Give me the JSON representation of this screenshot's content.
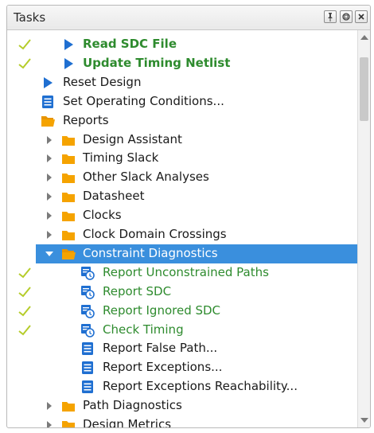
{
  "panel": {
    "title": "Tasks",
    "buttons": [
      "pin-icon",
      "float-icon",
      "close-icon"
    ]
  },
  "tree": {
    "items": [
      {
        "label": "Read SDC File",
        "checked": true,
        "icon": "play-icon",
        "indent": 1,
        "expander": "none",
        "bold": true,
        "green": true
      },
      {
        "label": "Update Timing Netlist",
        "checked": true,
        "icon": "play-icon",
        "indent": 1,
        "expander": "none",
        "bold": true,
        "green": true
      },
      {
        "label": "Reset Design",
        "checked": false,
        "icon": "play-icon",
        "indent": 0,
        "expander": "none",
        "bold": false,
        "green": false
      },
      {
        "label": "Set Operating Conditions...",
        "checked": false,
        "icon": "list-icon",
        "indent": 0,
        "expander": "none",
        "bold": false,
        "green": false
      },
      {
        "label": "Reports",
        "checked": false,
        "icon": "folder-open-icon",
        "indent": 0,
        "expander": "none",
        "bold": false,
        "green": false
      },
      {
        "label": "Design Assistant",
        "checked": false,
        "icon": "folder-icon",
        "indent": 1,
        "expander": "collapsed",
        "bold": false,
        "green": false
      },
      {
        "label": "Timing Slack",
        "checked": false,
        "icon": "folder-icon",
        "indent": 1,
        "expander": "collapsed",
        "bold": false,
        "green": false
      },
      {
        "label": "Other Slack Analyses",
        "checked": false,
        "icon": "folder-icon",
        "indent": 1,
        "expander": "collapsed",
        "bold": false,
        "green": false
      },
      {
        "label": "Datasheet",
        "checked": false,
        "icon": "folder-icon",
        "indent": 1,
        "expander": "collapsed",
        "bold": false,
        "green": false
      },
      {
        "label": "Clocks",
        "checked": false,
        "icon": "folder-icon",
        "indent": 1,
        "expander": "collapsed",
        "bold": false,
        "green": false
      },
      {
        "label": "Clock Domain Crossings",
        "checked": false,
        "icon": "folder-icon",
        "indent": 1,
        "expander": "collapsed",
        "bold": false,
        "green": false
      },
      {
        "label": "Constraint Diagnostics",
        "checked": false,
        "icon": "folder-open-icon",
        "indent": 1,
        "expander": "expanded",
        "bold": false,
        "green": false,
        "selected": true
      },
      {
        "label": "Report Unconstrained Paths",
        "checked": true,
        "icon": "report-clock-icon",
        "indent": 2,
        "expander": "none",
        "bold": false,
        "green": true
      },
      {
        "label": "Report SDC",
        "checked": true,
        "icon": "report-clock-icon",
        "indent": 2,
        "expander": "none",
        "bold": false,
        "green": true
      },
      {
        "label": "Report Ignored SDC",
        "checked": true,
        "icon": "report-clock-icon",
        "indent": 2,
        "expander": "none",
        "bold": false,
        "green": true
      },
      {
        "label": "Check Timing",
        "checked": true,
        "icon": "report-clock-icon",
        "indent": 2,
        "expander": "none",
        "bold": false,
        "green": true
      },
      {
        "label": "Report False Path...",
        "checked": false,
        "icon": "list-icon",
        "indent": 2,
        "expander": "none",
        "bold": false,
        "green": false
      },
      {
        "label": "Report Exceptions...",
        "checked": false,
        "icon": "list-icon",
        "indent": 2,
        "expander": "none",
        "bold": false,
        "green": false
      },
      {
        "label": "Report Exceptions Reachability...",
        "checked": false,
        "icon": "list-icon",
        "indent": 2,
        "expander": "none",
        "bold": false,
        "green": false
      },
      {
        "label": "Path Diagnostics",
        "checked": false,
        "icon": "folder-icon",
        "indent": 1,
        "expander": "collapsed",
        "bold": false,
        "green": false
      },
      {
        "label": "Design Metrics",
        "checked": false,
        "icon": "folder-icon",
        "indent": 1,
        "expander": "collapsed",
        "bold": false,
        "green": false
      }
    ]
  },
  "colors": {
    "check": "#b5cc2a",
    "play": "#1f6fd1",
    "folder": "#f5a300",
    "selection": "#3a8fdd",
    "done_text": "#2e8b2e"
  }
}
